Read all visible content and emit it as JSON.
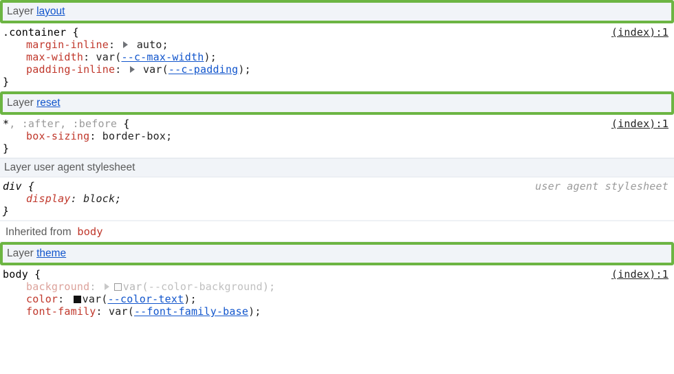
{
  "layerWord": "Layer",
  "inheritedPrefix": "Inherited from",
  "layers": {
    "layout": {
      "name": "layout",
      "word": "Layer"
    },
    "reset": {
      "name": "reset",
      "word": "Layer"
    },
    "uaLayer": {
      "label": "Layer user agent stylesheet"
    },
    "theme": {
      "name": "theme",
      "word": "Layer"
    }
  },
  "container": {
    "selector": ".container",
    "open": " {",
    "close": "}",
    "source": "(index):1",
    "d1": {
      "prop": "margin-inline",
      "val": "auto",
      "colon": ": ",
      "semi": ";"
    },
    "d2": {
      "prop": "max-width",
      "fn": "var(",
      "var": "--c-max-width",
      "tail": ");",
      "colon": ": "
    },
    "d3": {
      "prop": "padding-inline",
      "fn": "var(",
      "var": "--c-padding",
      "tail": ");",
      "colon": ": "
    }
  },
  "reset": {
    "selStar": "*",
    "selRest": ", :after, :before",
    "open": " {",
    "close": "}",
    "source": "(index):1",
    "d1": {
      "prop": "box-sizing",
      "val": "border-box",
      "colon": ": ",
      "semi": ";"
    }
  },
  "ua": {
    "selector": "div",
    "open": " {",
    "close": "}",
    "sourceLabel": "user agent stylesheet",
    "d1": {
      "prop": "display",
      "val": "block",
      "colon": ": ",
      "semi": ";"
    }
  },
  "inherited": {
    "from": "body"
  },
  "body": {
    "selector": "body",
    "open": " {",
    "close": "}",
    "source": "(index):1",
    "bg": {
      "prop": "background",
      "fn": "var(",
      "var": "--color-background",
      "tail": ");",
      "colon": ": "
    },
    "col": {
      "prop": "color",
      "fn": "var(",
      "var": "--color-text",
      "tail": ");",
      "colon": ": "
    },
    "ff": {
      "prop": "font-family",
      "fn": "var(",
      "var": "--font-family-base",
      "tail": ");",
      "colon": ": "
    }
  }
}
